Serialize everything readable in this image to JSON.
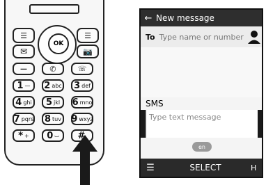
{
  "phone": {
    "nav_center_label": "OK",
    "keys": [
      {
        "name": "left-softkey",
        "label": ""
      },
      {
        "name": "right-softkey",
        "label": ""
      },
      {
        "name": "message-key",
        "label": ""
      },
      {
        "name": "camera-key",
        "label": ""
      },
      {
        "name": "call-key",
        "label": ""
      },
      {
        "name": "whatsapp-key",
        "label": ""
      },
      {
        "name": "end-key",
        "label": ""
      },
      {
        "name": "key-1",
        "label": "1",
        "sub": "—"
      },
      {
        "name": "key-2",
        "label": "2",
        "sub": "abc"
      },
      {
        "name": "key-3",
        "label": "3",
        "sub": "def"
      },
      {
        "name": "key-4",
        "label": "4",
        "sub": "ghi"
      },
      {
        "name": "key-5",
        "label": "5",
        "sub": "jkl"
      },
      {
        "name": "key-6",
        "label": "6",
        "sub": "mno"
      },
      {
        "name": "key-7",
        "label": "7",
        "sub": "pqrs"
      },
      {
        "name": "key-8",
        "label": "8",
        "sub": "tuv"
      },
      {
        "name": "key-9",
        "label": "9",
        "sub": "wxyz"
      },
      {
        "name": "key-star",
        "label": "*",
        "sub": "+"
      },
      {
        "name": "key-0",
        "label": "0",
        "sub": "⌴"
      },
      {
        "name": "key-hash",
        "label": "#",
        "sub": ""
      }
    ]
  },
  "screen": {
    "title": "New message",
    "to_label": "To",
    "to_placeholder": "Type name or number",
    "sms_label": "SMS",
    "text_placeholder": "Type text message",
    "language": "en",
    "softkey_center": "SELECT"
  }
}
